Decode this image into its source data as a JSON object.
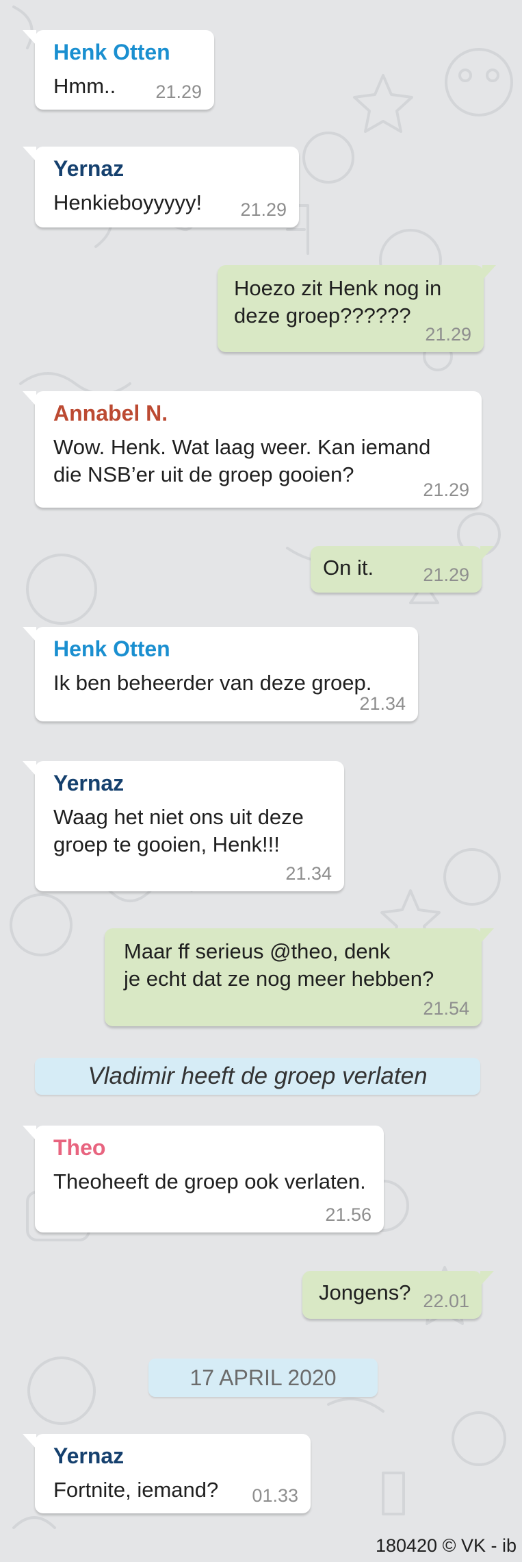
{
  "colors": {
    "background": "#e4e5e7",
    "incoming_bubble": "#ffffff",
    "outgoing_bubble": "#d9e8c5",
    "system_bubble": "#d6ecf6",
    "sender_henk": "#1a8fd0",
    "sender_yernaz": "#15406e",
    "sender_annabel": "#bc4a32",
    "sender_theo": "#e8647f",
    "timestamp": "#8e8e8e"
  },
  "messages": [
    {
      "type": "in",
      "sender": "Henk Otten",
      "lines": [
        "Hmm.."
      ],
      "time": "21.29"
    },
    {
      "type": "in",
      "sender": "Yernaz",
      "lines": [
        "Henkieboyyyyy!"
      ],
      "time": "21.29"
    },
    {
      "type": "out",
      "lines": [
        "Hoezo zit Henk nog in",
        "deze groep??????"
      ],
      "time": "21.29"
    },
    {
      "type": "in",
      "sender": "Annabel N.",
      "lines": [
        "Wow. Henk. Wat laag weer. Kan iemand",
        "die NSB’er uit de groep gooien?"
      ],
      "time": "21.29"
    },
    {
      "type": "out",
      "lines": [
        "On it."
      ],
      "time": "21.29"
    },
    {
      "type": "in",
      "sender": "Henk Otten",
      "lines": [
        "Ik ben beheerder van deze groep."
      ],
      "time": "21.34"
    },
    {
      "type": "in",
      "sender": "Yernaz",
      "lines": [
        "Waag het niet ons uit deze",
        "groep te gooien, Henk!!!"
      ],
      "time": "21.34"
    },
    {
      "type": "out",
      "lines": [
        "Maar ff serieus @theo, denk",
        "je echt dat ze nog meer hebben?"
      ],
      "time": "21.54"
    },
    {
      "type": "system",
      "text": "Vladimir heeft de groep verlaten"
    },
    {
      "type": "in",
      "sender": "Theo",
      "lines": [
        "Theoheeft de groep ook verlaten."
      ],
      "time": "21.56"
    },
    {
      "type": "out",
      "lines": [
        "Jongens?"
      ],
      "time": "22.01"
    },
    {
      "type": "date",
      "text": "17 APRIL 2020"
    },
    {
      "type": "in",
      "sender": "Yernaz",
      "lines": [
        "Fortnite, iemand?"
      ],
      "time": "01.33"
    }
  ],
  "credit": "180420 © VK - ib"
}
